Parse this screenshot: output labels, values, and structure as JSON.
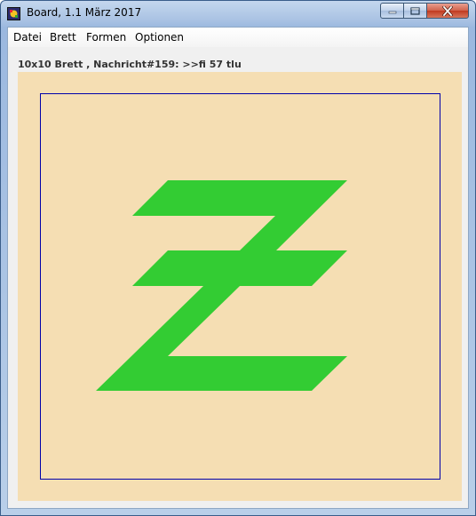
{
  "window": {
    "title": "Board, 1.1 März 2017"
  },
  "menu": [
    "Datei",
    "Brett",
    "Formen",
    "Optionen"
  ],
  "status": {
    "text": "10x10 Brett , Nachricht#159: >>fi 57 tlu"
  },
  "colors": {
    "board_background": "#f5deb3",
    "frame": "#0000aa",
    "shape_fill": "#33cc33"
  },
  "icons": {
    "app": "board-app-icon",
    "minimize": "minimize-icon",
    "maximize": "maximize-icon",
    "close": "close-icon"
  },
  "board": {
    "shape": "green Z with horizontal stroke"
  }
}
